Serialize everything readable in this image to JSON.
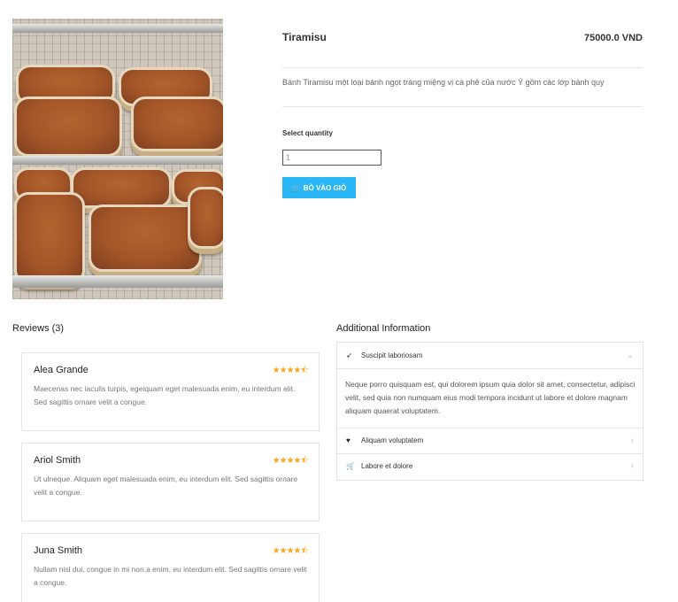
{
  "product": {
    "title": "Tiramisu",
    "price": "75000.0 VND",
    "description": "Bánh Tiramisu một loại bánh ngọt tráng miệng vị cà phê của nước Ý gồm các lớp bánh quy",
    "image_icon": "tiramisu-photo",
    "quantity_label": "Select quantity",
    "quantity_value": "1",
    "add_to_cart_label": "BỎ VÀO GIỎ",
    "add_to_cart_icon": "cart-icon",
    "accent_color": "#29b6f6"
  },
  "reviews": {
    "heading": "Reviews (3)",
    "star_color": "#f5a623",
    "items": [
      {
        "name": "Alea Grande",
        "stars": "★★★★⯪",
        "rating": 4.5,
        "text": "Maecenas nec iaculis turpis, egeiquam eget malesuada enim, eu interdum elit. Sed sagittis ornare velit a congue."
      },
      {
        "name": "Ariol Smith",
        "stars": "★★★★⯪",
        "rating": 4.5,
        "text": "Ut ulneque. Aliquam eget malesuada enim, eu interdum elit. Sed sagittis ornare velit a congue."
      },
      {
        "name": "Juna Smith",
        "stars": "★★★★⯪",
        "rating": 4.5,
        "text": "Nullam nisl dui, congue in mi non,a enim, eu interdum elit. Sed sagittis ornare velit a congue."
      }
    ]
  },
  "additional": {
    "heading": "Additional Information",
    "items": [
      {
        "label": "Suscipit laboriosam",
        "icon": "rocket-icon",
        "glyph": "➶",
        "chevron": "⌄",
        "expanded": true,
        "body": "Neque porro quisquam est, qui dolorem ipsum quia dolor sit amet, consectetur, adipisci velit, sed quia non numquam eius modi tempora incidunt ut labore et dolore magnam aliquam quaerat voluptatem."
      },
      {
        "label": "Aliquam voluptatem",
        "icon": "heart-icon",
        "glyph": "♥",
        "chevron": "›",
        "expanded": false
      },
      {
        "label": "Labore et dolore",
        "icon": "cart-icon",
        "glyph": "🛒",
        "chevron": "›",
        "expanded": false
      }
    ]
  }
}
